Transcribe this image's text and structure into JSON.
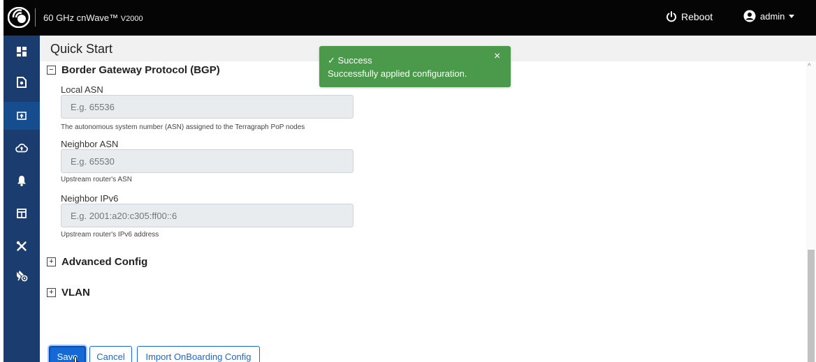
{
  "header": {
    "app_title": "60 GHz cnWave™",
    "app_model": "V2000",
    "reboot_label": "Reboot",
    "user_label": "admin"
  },
  "sidebar": {
    "items": [
      {
        "icon": "dashboard-icon"
      },
      {
        "icon": "document-icon"
      },
      {
        "icon": "upload-icon",
        "active": true
      },
      {
        "icon": "cloud-upload-icon"
      },
      {
        "icon": "bell-icon"
      },
      {
        "icon": "table-icon"
      },
      {
        "icon": "tools-icon"
      },
      {
        "icon": "satellite-settings-icon"
      }
    ]
  },
  "page": {
    "title": "Quick Start"
  },
  "bgp": {
    "heading": "Border Gateway Protocol (BGP)",
    "toggle": "−",
    "local_asn": {
      "label": "Local ASN",
      "placeholder": "E.g. 65536",
      "value": "",
      "help": "The autonomous system number (ASN) assigned to the Terragraph PoP nodes"
    },
    "neighbor_asn": {
      "label": "Neighbor ASN",
      "placeholder": "E.g. 65530",
      "value": "",
      "help": "Upstream router's ASN"
    },
    "neighbor_ipv6": {
      "label": "Neighbor IPv6",
      "placeholder": "E.g. 2001:a20:c305:ff00::6",
      "value": "",
      "help": "Upstream router's IPv6 address"
    }
  },
  "advanced": {
    "heading": "Advanced Config",
    "toggle": "+"
  },
  "vlan": {
    "heading": "VLAN",
    "toggle": "+"
  },
  "buttons": {
    "save": "Save",
    "cancel": "Cancel",
    "import": "Import OnBoarding Config"
  },
  "toast": {
    "title": "✓ Success",
    "message": "Successfully applied configuration.",
    "close": "×"
  },
  "colors": {
    "topbar": "#050505",
    "sidebar": "#1a3c6e",
    "primary": "#1469d6",
    "success": "#4b9a4b"
  }
}
